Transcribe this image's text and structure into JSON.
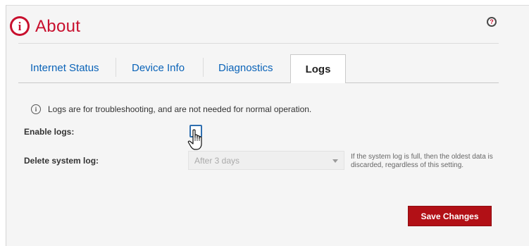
{
  "header": {
    "title": "About",
    "help_glyph": "?"
  },
  "tabs": [
    {
      "label": "Internet Status",
      "active": false
    },
    {
      "label": "Device Info",
      "active": false
    },
    {
      "label": "Diagnostics",
      "active": false
    },
    {
      "label": "Logs",
      "active": true
    }
  ],
  "info": {
    "text": "Logs are for troubleshooting, and are not needed for normal operation."
  },
  "form": {
    "enable_logs_label": "Enable logs:",
    "enable_logs_checked": false,
    "delete_log_label": "Delete system log:",
    "delete_log_value": "After 3 days",
    "delete_log_hint": "If the system log is full, then the oldest data is discarded, regardless of this setting."
  },
  "actions": {
    "save_label": "Save Changes"
  },
  "colors": {
    "accent": "#c8102e",
    "link": "#0a63b8",
    "button": "#b21016"
  },
  "icons": {
    "header": "info-circle-icon",
    "help": "help-icon",
    "info": "info-icon",
    "cursor": "hand-pointer-icon",
    "dropdown": "chevron-down-icon"
  }
}
